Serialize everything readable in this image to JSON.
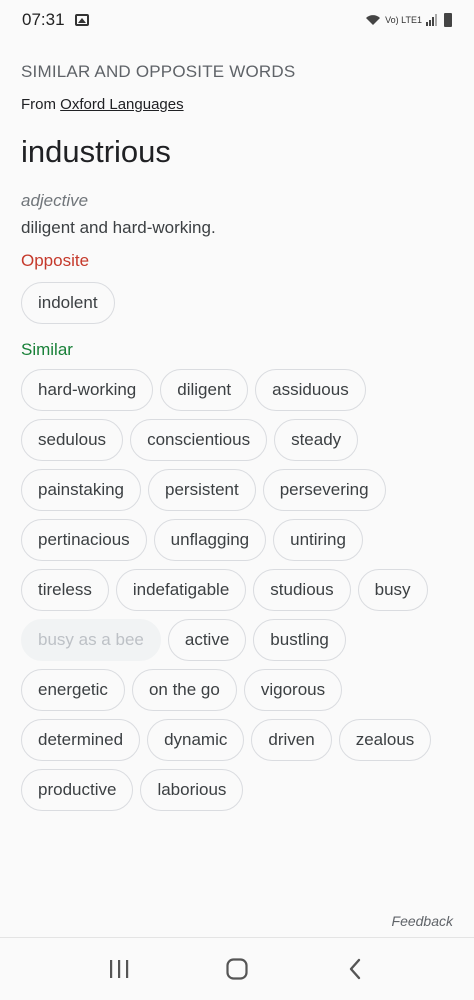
{
  "status": {
    "time": "07:31",
    "network": "Vo) LTE1"
  },
  "header": {
    "section_title": "SIMILAR AND OPPOSITE WORDS",
    "from_prefix": "From",
    "source": "Oxford Languages"
  },
  "entry": {
    "word": "industrious",
    "part_of_speech": "adjective",
    "definition": "diligent and hard-working."
  },
  "opposite": {
    "label": "Opposite",
    "words": [
      "indolent"
    ]
  },
  "similar": {
    "label": "Similar",
    "words": [
      "hard-working",
      "diligent",
      "assiduous",
      "sedulous",
      "conscientious",
      "steady",
      "painstaking",
      "persistent",
      "persevering",
      "pertinacious",
      "unflagging",
      "untiring",
      "tireless",
      "indefatigable",
      "studious",
      "busy",
      "busy as a bee",
      "active",
      "bustling",
      "energetic",
      "on the go",
      "vigorous",
      "determined",
      "dynamic",
      "driven",
      "zealous",
      "productive",
      "laborious"
    ],
    "disabled_words": [
      "busy as a bee"
    ]
  },
  "footer": {
    "feedback": "Feedback"
  },
  "nav": {
    "icons": [
      "recent-apps-icon",
      "home-icon",
      "back-icon"
    ]
  }
}
